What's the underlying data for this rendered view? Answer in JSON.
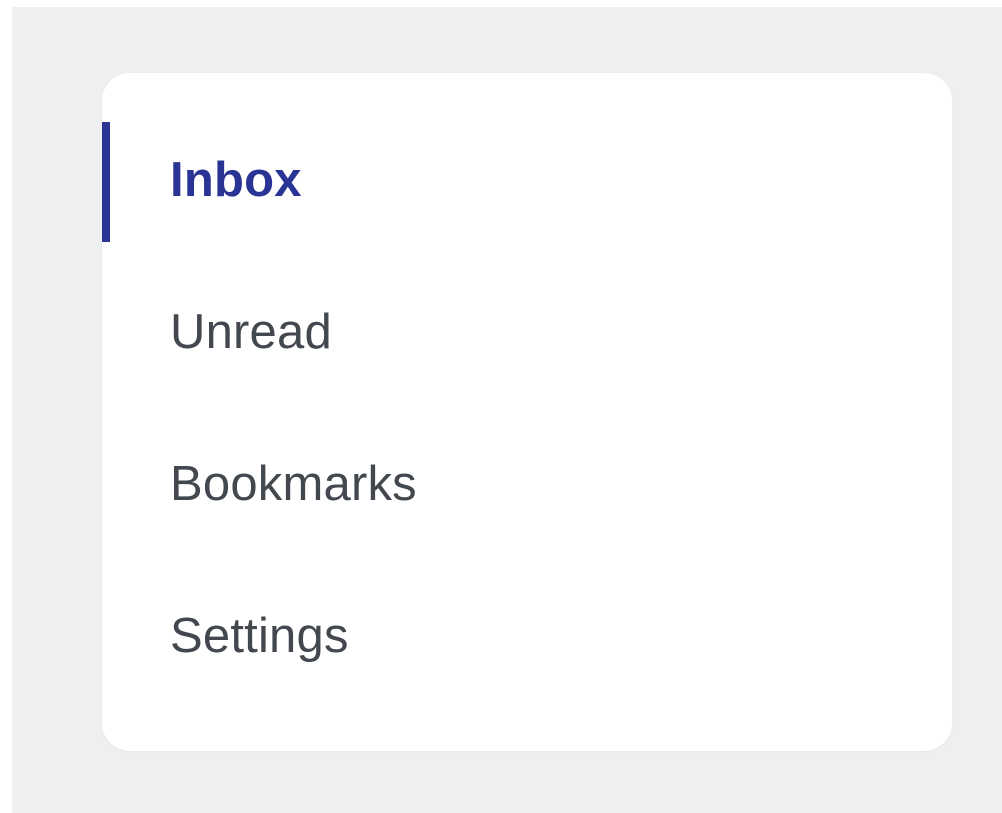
{
  "nav": {
    "items": [
      {
        "label": "Inbox",
        "active": true
      },
      {
        "label": "Unread",
        "active": false
      },
      {
        "label": "Bookmarks",
        "active": false
      },
      {
        "label": "Settings",
        "active": false
      }
    ]
  },
  "colors": {
    "background": "#eeeff1",
    "card": "#ffffff",
    "accent": "#293495",
    "text": "#43474e"
  }
}
